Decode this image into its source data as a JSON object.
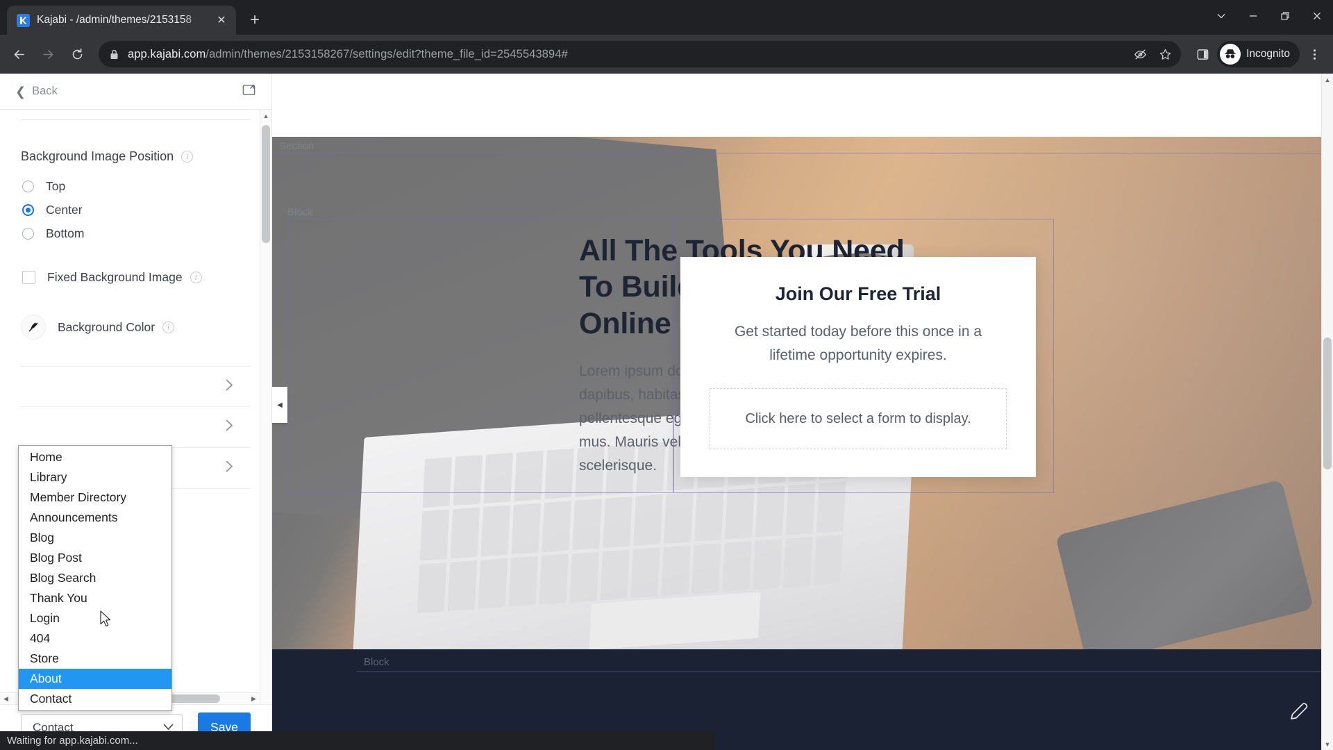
{
  "browser": {
    "tab": {
      "title": "Kajabi - /admin/themes/2153158",
      "favicon_icon": "kajabi-logo-icon",
      "close_icon": "close-icon"
    },
    "newtab_icon": "plus-icon",
    "window_controls": {
      "dropdown_icon": "chevron-down-icon",
      "minimize_icon": "minimize-icon",
      "maximize_icon": "restore-icon",
      "close_icon": "close-icon"
    },
    "nav": {
      "back_icon": "arrow-left-icon",
      "forward_icon": "arrow-right-icon",
      "reload_icon": "reload-icon"
    },
    "omnibox": {
      "lock_icon": "lock-icon",
      "url_host": "app.kajabi.com",
      "url_path": "/admin/themes/2153158267/settings/edit?theme_file_id=2545543894#",
      "tracking_icon": "eye-slash-icon",
      "bookmark_icon": "star-icon"
    },
    "toolbar_right": {
      "side_panel_icon": "side-panel-icon",
      "incognito_label": "Incognito",
      "incognito_icon": "incognito-avatar-icon",
      "menu_icon": "kebab-menu-icon"
    },
    "status_text": "Waiting for app.kajabi.com..."
  },
  "panel": {
    "back_label": "Back",
    "back_icon": "chevron-left-icon",
    "external_icon": "external-link-icon",
    "bg_position": {
      "label": "Background Image Position",
      "info_icon": "info-icon",
      "options": [
        {
          "label": "Top",
          "selected": false
        },
        {
          "label": "Center",
          "selected": true
        },
        {
          "label": "Bottom",
          "selected": false
        }
      ]
    },
    "fixed_bg": {
      "label": "Fixed Background Image",
      "checked": false,
      "info_icon": "info-icon"
    },
    "bg_color": {
      "label": "Background Color",
      "swatch_icon": "no-color-dropper-icon",
      "info_icon": "info-icon"
    },
    "collapsed_rows": [
      {
        "chevron_icon": "chevron-right-icon"
      },
      {
        "chevron_icon": "chevron-right-icon"
      },
      {
        "chevron_icon": "chevron-right-icon"
      }
    ],
    "red_note": "on",
    "footer": {
      "select_value": "Contact",
      "select_chevron_icon": "chevron-down-icon",
      "save_label": "Save"
    },
    "dropdown": {
      "options": [
        {
          "label": "Home",
          "selected": false
        },
        {
          "label": "Library",
          "selected": false
        },
        {
          "label": "Member Directory",
          "selected": false
        },
        {
          "label": "Announcements",
          "selected": false
        },
        {
          "label": "Blog",
          "selected": false
        },
        {
          "label": "Blog Post",
          "selected": false
        },
        {
          "label": "Blog Search",
          "selected": false
        },
        {
          "label": "Thank You",
          "selected": false
        },
        {
          "label": "Login",
          "selected": false
        },
        {
          "label": "404",
          "selected": false
        },
        {
          "label": "Store",
          "selected": false
        },
        {
          "label": "About",
          "selected": true
        },
        {
          "label": "Contact",
          "selected": false
        }
      ],
      "highlight_color": "#2196f3"
    },
    "scroll_left_icon": "triangle-left-icon",
    "scroll_right_icon": "triangle-right-icon",
    "scroll_up_icon": "triangle-up-icon",
    "scroll_down_icon": "triangle-down-icon"
  },
  "preview": {
    "section_label": "Section",
    "block_label": "Block",
    "block_label_bottom": "Block",
    "hero": {
      "heading": "All The Tools You Need To Build A Successful Online Business",
      "paragraph": "Lorem ipsum dolor sit amet, metus at rhoncus dapibus, habitasse vitae cubilia odio sed. Mauris pellentesque eget lorem malesuada wisi nec, nullam mus. Mauris vel mauris. Orci fusce ipsum faucibus scelerisque."
    },
    "card": {
      "title": "Join Our Free Trial",
      "subtitle": "Get started today before this once in a lifetime opportunity expires.",
      "form_placeholder": "Click here to select a form to display."
    },
    "collapse_handle_icon": "triangle-left-icon",
    "pencil_icon": "pencil-icon"
  }
}
